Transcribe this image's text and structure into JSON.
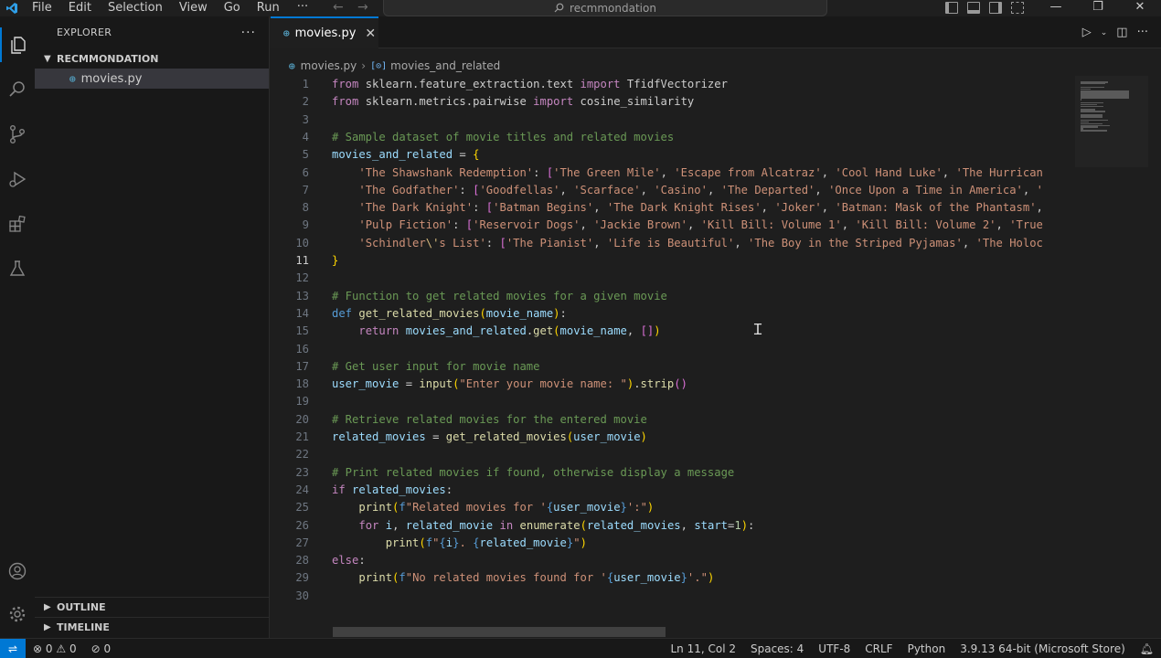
{
  "menu": [
    "File",
    "Edit",
    "Selection",
    "View",
    "Go",
    "Run"
  ],
  "menu_more": "···",
  "search_text": "recmmondation",
  "sidebar": {
    "title": "EXPLORER",
    "more": "···",
    "folder": "RECMMONDATION",
    "file": "movies.py",
    "outline": "OUTLINE",
    "timeline": "TIMELINE"
  },
  "tab": {
    "label": "movies.py",
    "close": "✕"
  },
  "breadcrumb": {
    "file": "movies.py",
    "symbol": "movies_and_related"
  },
  "code_lines": [
    {
      "n": "1",
      "html": "<span style='color:#c586c0'>from</span> sklearn.feature_extraction.text <span style='color:#c586c0'>import</span> TfidfVectorizer"
    },
    {
      "n": "2",
      "html": "<span style='color:#c586c0'>from</span> sklearn.metrics.pairwise <span style='color:#c586c0'>import</span> cosine_similarity"
    },
    {
      "n": "3",
      "html": ""
    },
    {
      "n": "4",
      "html": "<span style='color:#6a9955'># Sample dataset of movie titles and related movies</span>"
    },
    {
      "n": "5",
      "html": "<span style='color:#9cdcfe'>movies_and_related</span> = <span style='color:#ffd700'>{</span>"
    },
    {
      "n": "6",
      "html": "    <span style='color:#ce9178'>'The Shawshank Redemption'</span>: <span style='color:#da70d6'>[</span><span style='color:#ce9178'>'The Green Mile'</span>, <span style='color:#ce9178'>'Escape from Alcatraz'</span>, <span style='color:#ce9178'>'Cool Hand Luke'</span>, <span style='color:#ce9178'>'The Hurrican</span>"
    },
    {
      "n": "7",
      "html": "    <span style='color:#ce9178'>'The Godfather'</span>: <span style='color:#da70d6'>[</span><span style='color:#ce9178'>'Goodfellas'</span>, <span style='color:#ce9178'>'Scarface'</span>, <span style='color:#ce9178'>'Casino'</span>, <span style='color:#ce9178'>'The Departed'</span>, <span style='color:#ce9178'>'Once Upon a Time in America'</span>, <span style='color:#ce9178'>'</span>"
    },
    {
      "n": "8",
      "html": "    <span style='color:#ce9178'>'The Dark Knight'</span>: <span style='color:#da70d6'>[</span><span style='color:#ce9178'>'Batman Begins'</span>, <span style='color:#ce9178'>'The Dark Knight Rises'</span>, <span style='color:#ce9178'>'Joker'</span>, <span style='color:#ce9178'>'Batman: Mask of the Phantasm'</span>,"
    },
    {
      "n": "9",
      "html": "    <span style='color:#ce9178'>'Pulp Fiction'</span>: <span style='color:#da70d6'>[</span><span style='color:#ce9178'>'Reservoir Dogs'</span>, <span style='color:#ce9178'>'Jackie Brown'</span>, <span style='color:#ce9178'>'Kill Bill: Volume 1'</span>, <span style='color:#ce9178'>'Kill Bill: Volume 2'</span>, <span style='color:#ce9178'>'True</span>"
    },
    {
      "n": "10",
      "html": "    <span style='color:#ce9178'>'Schindler</span><span style='color:#d7ba7d'>\\'</span><span style='color:#ce9178'>s List'</span>: <span style='color:#da70d6'>[</span><span style='color:#ce9178'>'The Pianist'</span>, <span style='color:#ce9178'>'Life is Beautiful'</span>, <span style='color:#ce9178'>'The Boy in the Striped Pyjamas'</span>, <span style='color:#ce9178'>'The Holoc</span>"
    },
    {
      "n": "11",
      "html": "<span style='color:#ffd700'>}</span>",
      "current": true
    },
    {
      "n": "12",
      "html": ""
    },
    {
      "n": "13",
      "html": "<span style='color:#6a9955'># Function to get related movies for a given movie</span>"
    },
    {
      "n": "14",
      "html": "<span style='color:#569cd6'>def</span> <span style='color:#dcdcaa'>get_related_movies</span><span style='color:#ffd700'>(</span><span style='color:#9cdcfe'>movie_name</span><span style='color:#ffd700'>)</span>:"
    },
    {
      "n": "15",
      "html": "    <span style='color:#c586c0'>return</span> <span style='color:#9cdcfe'>movies_and_related</span>.<span style='color:#dcdcaa'>get</span><span style='color:#ffd700'>(</span><span style='color:#9cdcfe'>movie_name</span>, <span style='color:#da70d6'>[]</span><span style='color:#ffd700'>)</span>"
    },
    {
      "n": "16",
      "html": ""
    },
    {
      "n": "17",
      "html": "<span style='color:#6a9955'># Get user input for movie name</span>"
    },
    {
      "n": "18",
      "html": "<span style='color:#9cdcfe'>user_movie</span> = <span style='color:#dcdcaa'>input</span><span style='color:#ffd700'>(</span><span style='color:#ce9178'>\"Enter your movie name: \"</span><span style='color:#ffd700'>)</span>.<span style='color:#dcdcaa'>strip</span><span style='color:#da70d6'>()</span>"
    },
    {
      "n": "19",
      "html": ""
    },
    {
      "n": "20",
      "html": "<span style='color:#6a9955'># Retrieve related movies for the entered movie</span>"
    },
    {
      "n": "21",
      "html": "<span style='color:#9cdcfe'>related_movies</span> = <span style='color:#dcdcaa'>get_related_movies</span><span style='color:#ffd700'>(</span><span style='color:#9cdcfe'>user_movie</span><span style='color:#ffd700'>)</span>"
    },
    {
      "n": "22",
      "html": ""
    },
    {
      "n": "23",
      "html": "<span style='color:#6a9955'># Print related movies if found, otherwise display a message</span>"
    },
    {
      "n": "24",
      "html": "<span style='color:#c586c0'>if</span> <span style='color:#9cdcfe'>related_movies</span>:"
    },
    {
      "n": "25",
      "html": "    <span style='color:#dcdcaa'>print</span><span style='color:#ffd700'>(</span><span style='color:#569cd6'>f</span><span style='color:#ce9178'>\"Related movies for '</span><span style='color:#569cd6'>{</span><span style='color:#9cdcfe'>user_movie</span><span style='color:#569cd6'>}</span><span style='color:#ce9178'>':\"</span><span style='color:#ffd700'>)</span>"
    },
    {
      "n": "26",
      "html": "    <span style='color:#c586c0'>for</span> <span style='color:#9cdcfe'>i</span>, <span style='color:#9cdcfe'>related_movie</span> <span style='color:#c586c0'>in</span> <span style='color:#dcdcaa'>enumerate</span><span style='color:#ffd700'>(</span><span style='color:#9cdcfe'>related_movies</span>, <span style='color:#9cdcfe'>start</span>=<span style='color:#b5cea8'>1</span><span style='color:#ffd700'>)</span>:"
    },
    {
      "n": "27",
      "html": "        <span style='color:#dcdcaa'>print</span><span style='color:#ffd700'>(</span><span style='color:#569cd6'>f</span><span style='color:#ce9178'>\"</span><span style='color:#569cd6'>{</span><span style='color:#9cdcfe'>i</span><span style='color:#569cd6'>}</span><span style='color:#ce9178'>. </span><span style='color:#569cd6'>{</span><span style='color:#9cdcfe'>related_movie</span><span style='color:#569cd6'>}</span><span style='color:#ce9178'>\"</span><span style='color:#ffd700'>)</span>"
    },
    {
      "n": "28",
      "html": "<span style='color:#c586c0'>else</span>:"
    },
    {
      "n": "29",
      "html": "    <span style='color:#dcdcaa'>print</span><span style='color:#ffd700'>(</span><span style='color:#569cd6'>f</span><span style='color:#ce9178'>\"No related movies found for '</span><span style='color:#569cd6'>{</span><span style='color:#9cdcfe'>user_movie</span><span style='color:#569cd6'>}</span><span style='color:#ce9178'>'.\"</span><span style='color:#ffd700'>)</span>"
    },
    {
      "n": "30",
      "html": ""
    }
  ],
  "status": {
    "errors": "0",
    "warnings": "0",
    "ports": "0",
    "position": "Ln 11, Col 2",
    "spaces": "Spaces: 4",
    "encoding": "UTF-8",
    "eol": "CRLF",
    "language": "Python",
    "interpreter": "3.9.13 64-bit (Microsoft Store)"
  },
  "colors": {
    "accent": "#0078d4",
    "editor_bg": "#1e1e1e",
    "sidebar_bg": "#181818"
  }
}
